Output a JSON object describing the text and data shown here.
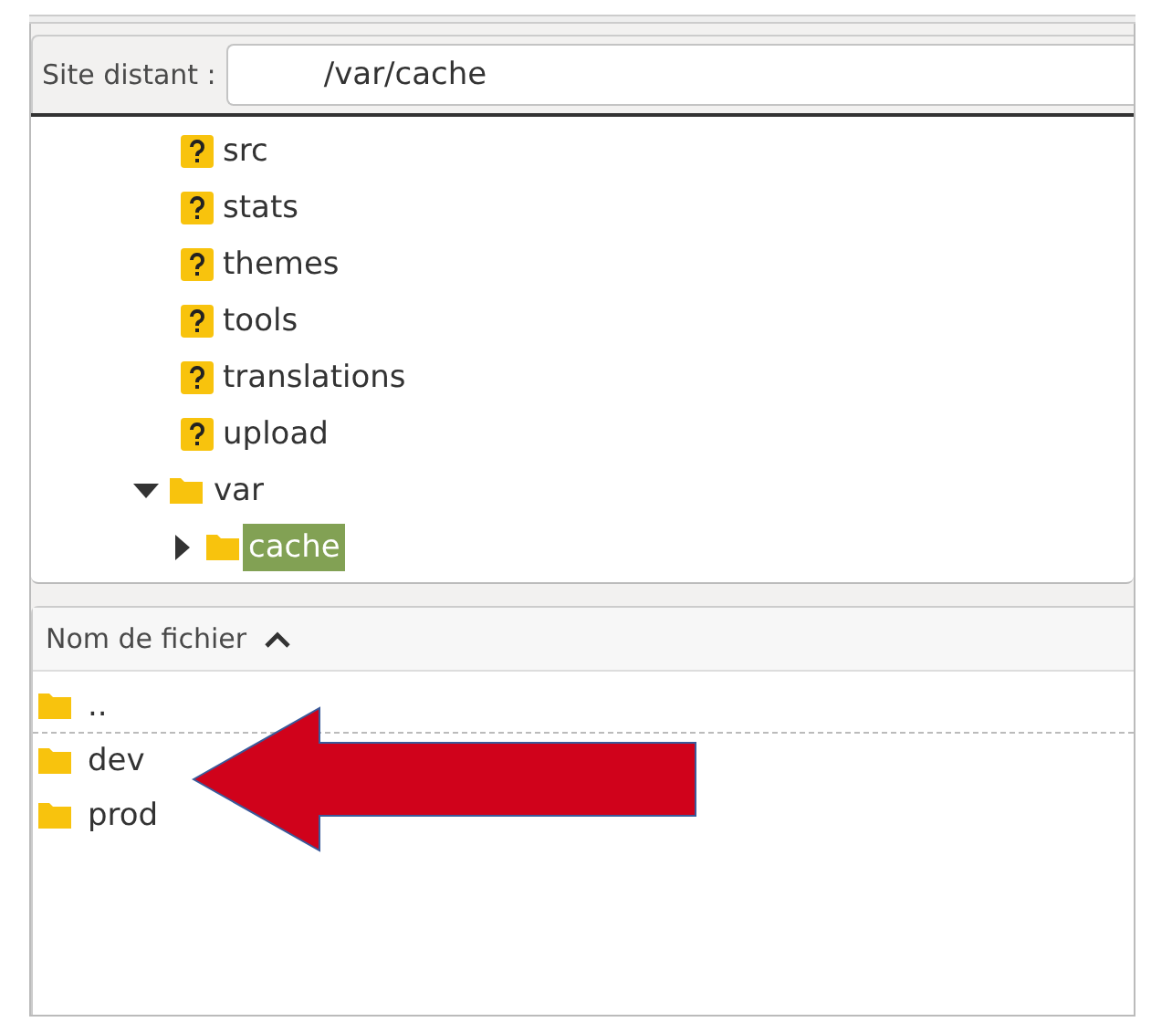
{
  "remote_site": {
    "label": "Site distant :",
    "value": "/var/cache"
  },
  "tree": [
    {
      "name": "src",
      "kind": "unknown",
      "selected": false
    },
    {
      "name": "stats",
      "kind": "unknown",
      "selected": false
    },
    {
      "name": "themes",
      "kind": "unknown",
      "selected": false
    },
    {
      "name": "tools",
      "kind": "unknown",
      "selected": false
    },
    {
      "name": "translations",
      "kind": "unknown",
      "selected": false
    },
    {
      "name": "upload",
      "kind": "unknown",
      "selected": false
    },
    {
      "name": "var",
      "kind": "folder",
      "selected": false,
      "expanded": true,
      "children": [
        {
          "name": "cache",
          "kind": "folder",
          "selected": true,
          "expanded": false
        }
      ]
    }
  ],
  "file_list": {
    "columns": [
      {
        "label": "Nom de fichier",
        "sorted": true
      }
    ],
    "rows": [
      {
        "name": ".."
      },
      {
        "name": "dev"
      },
      {
        "name": "prod"
      }
    ]
  }
}
